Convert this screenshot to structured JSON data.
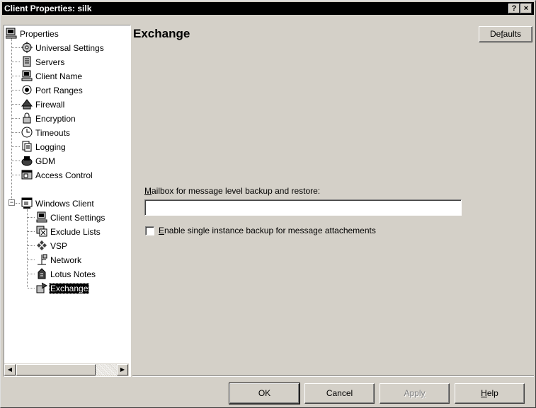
{
  "window": {
    "title": "Client Properties: silk",
    "help_glyph": "?",
    "close_glyph": "×"
  },
  "tree": {
    "root": {
      "label": "Properties",
      "icon": "computer-icon"
    },
    "items": [
      {
        "label": "Universal Settings",
        "icon": "gears-icon"
      },
      {
        "label": "Servers",
        "icon": "server-icon"
      },
      {
        "label": "Client Name",
        "icon": "computer-icon"
      },
      {
        "label": "Port Ranges",
        "icon": "port-icon"
      },
      {
        "label": "Firewall",
        "icon": "firewall-icon"
      },
      {
        "label": "Encryption",
        "icon": "lock-icon"
      },
      {
        "label": "Timeouts",
        "icon": "clock-icon"
      },
      {
        "label": "Logging",
        "icon": "log-icon"
      },
      {
        "label": "GDM",
        "icon": "gdm-icon"
      },
      {
        "label": "Access Control",
        "icon": "access-icon"
      },
      {
        "label": "Windows Client",
        "icon": "window-icon",
        "expanded": true
      }
    ],
    "children": [
      {
        "label": "Client Settings",
        "icon": "computer-icon"
      },
      {
        "label": "Exclude Lists",
        "icon": "exclude-icon"
      },
      {
        "label": "VSP",
        "icon": "vsp-icon"
      },
      {
        "label": "Network",
        "icon": "network-icon"
      },
      {
        "label": "Lotus Notes",
        "icon": "lotus-icon"
      },
      {
        "label": "Exchange",
        "icon": "exchange-icon",
        "selected": true
      }
    ]
  },
  "main": {
    "title": "Exchange",
    "defaults_button": {
      "pre": "De",
      "u": "f",
      "post": "aults"
    },
    "mailbox_label": {
      "u": "M",
      "post": "ailbox for message level backup and restore:"
    },
    "mailbox_value": "",
    "single_instance": {
      "u": "E",
      "post": "nable single instance backup for message attachements",
      "checked": false
    }
  },
  "footer": {
    "ok": "OK",
    "cancel": "Cancel",
    "apply": {
      "pre": "Appl",
      "u": "y",
      "post": "",
      "enabled": false
    },
    "help": {
      "pre": "",
      "u": "H",
      "post": "elp"
    }
  }
}
